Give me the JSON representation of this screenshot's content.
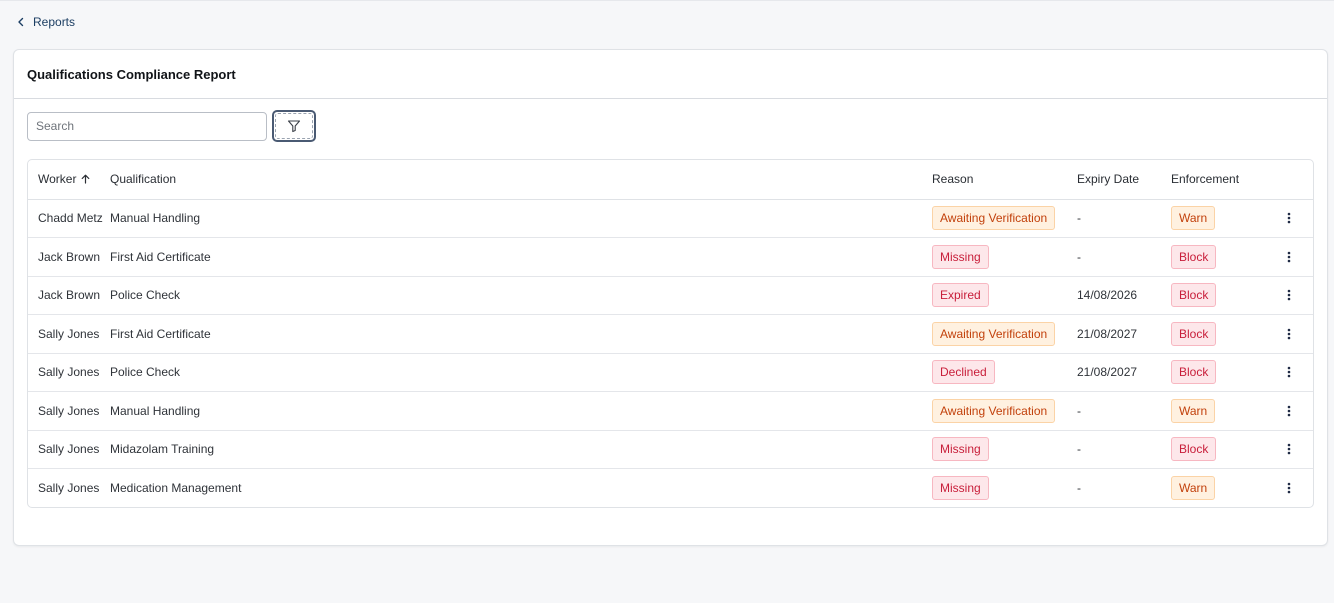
{
  "breadcrumb": {
    "label": "Reports",
    "icon": "chevron-left-icon"
  },
  "card": {
    "title": "Qualifications Compliance Report"
  },
  "search": {
    "placeholder": "Search",
    "value": ""
  },
  "filter": {
    "icon": "filter-icon"
  },
  "colors": {
    "link": "#1c3e63",
    "badge_orange_text": "#c2410c",
    "badge_red_text": "#c81e3a"
  },
  "table": {
    "columns": {
      "worker": "Worker",
      "qualification": "Qualification",
      "reason": "Reason",
      "expiry": "Expiry Date",
      "enforcement": "Enforcement"
    },
    "sort": {
      "column": "worker",
      "direction": "ascending",
      "icon": "arrow-up-icon"
    },
    "rows": [
      {
        "worker": "Chadd Metz",
        "qualification": "Manual Handling",
        "reason": "Awaiting Verification",
        "reason_tone": "orange",
        "expiry": "-",
        "enforcement": "Warn",
        "enforcement_tone": "orange"
      },
      {
        "worker": "Jack Brown",
        "qualification": "First Aid Certificate",
        "reason": "Missing",
        "reason_tone": "red",
        "expiry": "-",
        "enforcement": "Block",
        "enforcement_tone": "red"
      },
      {
        "worker": "Jack Brown",
        "qualification": "Police Check",
        "reason": "Expired",
        "reason_tone": "red",
        "expiry": "14/08/2026",
        "enforcement": "Block",
        "enforcement_tone": "red"
      },
      {
        "worker": "Sally Jones",
        "qualification": "First Aid Certificate",
        "reason": "Awaiting Verification",
        "reason_tone": "orange",
        "expiry": "21/08/2027",
        "enforcement": "Block",
        "enforcement_tone": "red"
      },
      {
        "worker": "Sally Jones",
        "qualification": "Police Check",
        "reason": "Declined",
        "reason_tone": "red",
        "expiry": "21/08/2027",
        "enforcement": "Block",
        "enforcement_tone": "red"
      },
      {
        "worker": "Sally Jones",
        "qualification": "Manual Handling",
        "reason": "Awaiting Verification",
        "reason_tone": "orange",
        "expiry": "-",
        "enforcement": "Warn",
        "enforcement_tone": "orange"
      },
      {
        "worker": "Sally Jones",
        "qualification": "Midazolam Training",
        "reason": "Missing",
        "reason_tone": "red",
        "expiry": "-",
        "enforcement": "Block",
        "enforcement_tone": "red"
      },
      {
        "worker": "Sally Jones",
        "qualification": "Medication Management",
        "reason": "Missing",
        "reason_tone": "red",
        "expiry": "-",
        "enforcement": "Warn",
        "enforcement_tone": "orange"
      }
    ]
  }
}
